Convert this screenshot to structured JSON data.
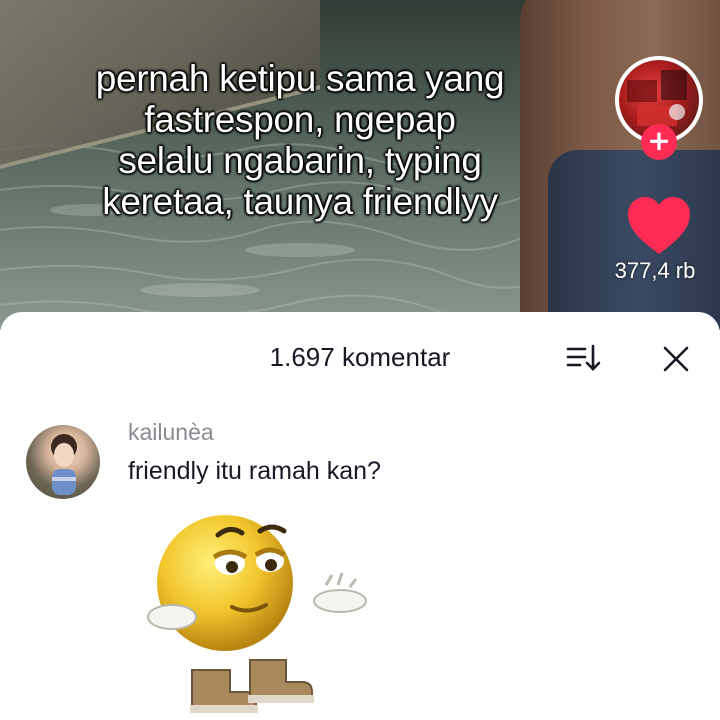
{
  "video": {
    "caption_lines": [
      "pernah ketipu sama yang",
      "fastrespon, ngepap",
      "selalu ngabarin, typing",
      "keretaa, taunya friendlyy"
    ],
    "follow_symbol": "+",
    "like_count": "377,4 rb",
    "heart_color": "#fe2c55"
  },
  "comments_panel": {
    "title": "1.697 komentar",
    "sort_icon": "sort-icon",
    "close_icon": "close-icon",
    "comments": [
      {
        "username": "kailunèa",
        "text": "friendly itu ramah kan?",
        "sticker": "shrugging-emoji-sticker"
      }
    ]
  }
}
